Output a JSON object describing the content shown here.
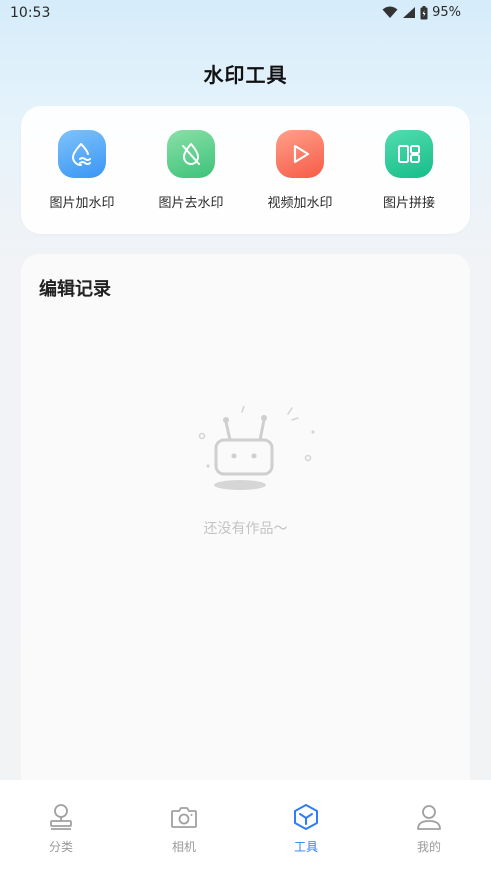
{
  "status_bar": {
    "time": "10:53",
    "battery": "95%"
  },
  "page": {
    "title": "水印工具"
  },
  "tools": [
    {
      "label": "图片加水印",
      "icon": "image-watermark-add-icon",
      "color_from": "#7ec3fb",
      "color_to": "#3a95f4"
    },
    {
      "label": "图片去水印",
      "icon": "image-watermark-remove-icon",
      "color_from": "#8be0a7",
      "color_to": "#3cc27a"
    },
    {
      "label": "视频加水印",
      "icon": "video-watermark-icon",
      "color_from": "#ffa08a",
      "color_to": "#f65b47"
    },
    {
      "label": "图片拼接",
      "icon": "image-collage-icon",
      "color_from": "#53dcb0",
      "color_to": "#16bd88"
    }
  ],
  "history": {
    "title": "编辑记录",
    "empty_text": "还没有作品～"
  },
  "tabbar": {
    "active_color": "#2f7df6",
    "items": [
      {
        "label": "分类",
        "icon": "stamp-icon",
        "active": false
      },
      {
        "label": "相机",
        "icon": "camera-icon",
        "active": false
      },
      {
        "label": "工具",
        "icon": "cube-icon",
        "active": true
      },
      {
        "label": "我的",
        "icon": "user-icon",
        "active": false
      }
    ]
  }
}
